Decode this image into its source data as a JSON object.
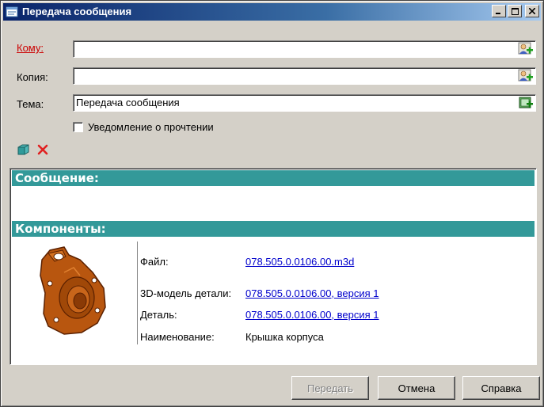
{
  "window": {
    "title": "Передача сообщения"
  },
  "form": {
    "to_label": "Кому:",
    "cc_label": "Копия:",
    "subject_label": "Тема:",
    "to_value": "",
    "cc_value": "",
    "subject_value": "Передача сообщения",
    "read_receipt_label": "Уведомление о прочтении"
  },
  "message": {
    "header": "Сообщение:",
    "body": ""
  },
  "components": {
    "header": "Компоненты:",
    "rows": [
      {
        "label": "Файл:",
        "value": "078.505.0.0106.00.m3d",
        "link": true
      },
      {
        "label": "3D-модель детали:",
        "value": "078.505.0.0106.00, версия 1",
        "link": true
      },
      {
        "label": "Деталь:",
        "value": "078.505.0.0106.00, версия 1",
        "link": true
      },
      {
        "label": "Наименование:",
        "value": "Крышка корпуса",
        "link": false
      }
    ]
  },
  "buttons": {
    "send": "Передать",
    "cancel": "Отмена",
    "help": "Справка"
  },
  "colors": {
    "section_header": "#339999",
    "link": "#0000cc",
    "required_label": "#cc0000"
  }
}
